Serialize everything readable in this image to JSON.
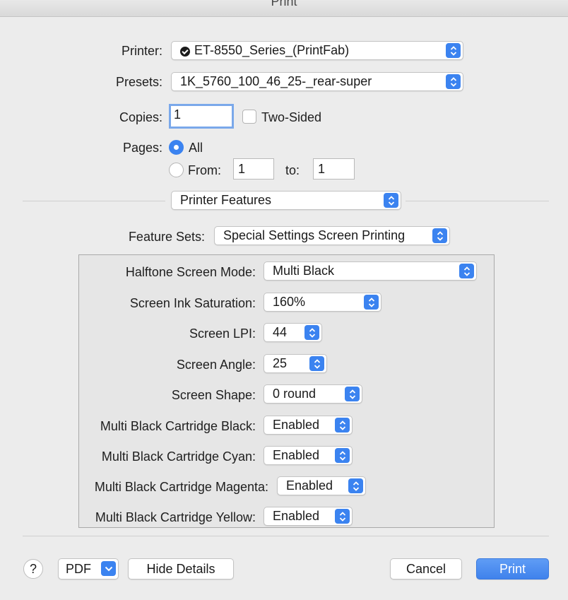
{
  "window": {
    "title": "Print"
  },
  "printer": {
    "label": "Printer:",
    "value": "ET-8550_Series_(PrintFab)"
  },
  "presets": {
    "label": "Presets:",
    "value": "1K_5760_100_46_25-_rear-super"
  },
  "copies": {
    "label": "Copies:",
    "value": "1",
    "two_sided_label": "Two-Sided"
  },
  "pages": {
    "label": "Pages:",
    "all_label": "All",
    "from_label": "From:",
    "from_value": "1",
    "to_label": "to:",
    "to_value": "1"
  },
  "section": {
    "value": "Printer Features"
  },
  "feature_sets": {
    "label": "Feature Sets:",
    "value": "Special Settings Screen Printing"
  },
  "settings": [
    {
      "label": "Halftone Screen Mode:",
      "value": "Multi Black"
    },
    {
      "label": "Screen Ink Saturation:",
      "value": "160%"
    },
    {
      "label": "Screen LPI:",
      "value": "44"
    },
    {
      "label": "Screen Angle:",
      "value": "25"
    },
    {
      "label": "Screen Shape:",
      "value": "0 round"
    },
    {
      "label": "Multi Black Cartridge Black:",
      "value": "Enabled"
    },
    {
      "label": "Multi Black Cartridge Cyan:",
      "value": "Enabled"
    },
    {
      "label": "Multi Black Cartridge Magenta:",
      "value": "Enabled"
    },
    {
      "label": "Multi Black Cartridge Yellow:",
      "value": "Enabled"
    }
  ],
  "footer": {
    "help_label": "?",
    "pdf_label": "PDF",
    "hide_details_label": "Hide Details",
    "cancel_label": "Cancel",
    "print_label": "Print"
  },
  "colors": {
    "accent": "#3b83f0",
    "background": "#ececec"
  }
}
